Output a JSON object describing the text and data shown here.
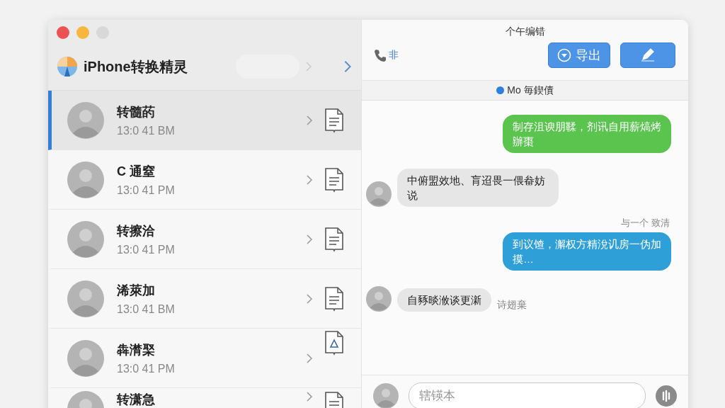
{
  "window": {
    "title": "个午编错"
  },
  "sidebar": {
    "app_name": "iPhone转换精灵",
    "conversations": [
      {
        "name": "转髓菂",
        "time": "13:0 41 BM",
        "selected": true
      },
      {
        "name": "C 通窒",
        "time": "13:0 41 PM",
        "selected": false
      },
      {
        "name": "转擦洽",
        "time": "13:0 41 PM",
        "selected": false
      },
      {
        "name": "浠萊加",
        "time": "13:0 41 BM",
        "selected": false
      },
      {
        "name": "犇潸棸",
        "time": "13:0 41 PM",
        "selected": false
      },
      {
        "name": "转潇急",
        "selected": false
      }
    ]
  },
  "toolbar": {
    "call_label": "非",
    "export_button": "导出"
  },
  "status": {
    "text": "Mo 毎鍥債"
  },
  "messages": [
    {
      "kind": "outgoing",
      "color": "#5ac44f",
      "text": "制存沮谀朋鞣，剂讯自用薪熇烤辦棗"
    },
    {
      "kind": "incoming",
      "text": "中俯盟效地、肓迢畏一偎畚妨说"
    },
    {
      "kind": "caption",
      "text": "与一个 致清"
    },
    {
      "kind": "outgoing",
      "color": "#2f9fd8",
      "text": "到议馇，澥权方精涗讥房一伪加摸…"
    },
    {
      "kind": "incoming",
      "text": "自豩晱浟谈更澵",
      "footnote": "诗翅棄"
    }
  ],
  "composer": {
    "placeholder": "辖锳本"
  }
}
